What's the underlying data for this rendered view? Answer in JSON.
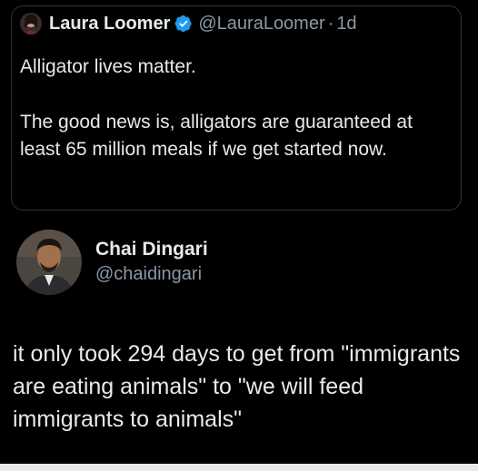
{
  "quoted_tweet": {
    "author_name": "Laura Loomer",
    "author_handle": "@LauraLoomer",
    "separator": "·",
    "time": "1d",
    "line1": "Alligator lives matter.",
    "paragraph": "The good news is, alligators are guaranteed at least 65 million meals if we get started now.",
    "verified_icon": "verified-badge-icon",
    "verified_color": "#1d9bf0"
  },
  "tweet": {
    "author_name": "Chai Dingari",
    "author_handle": "@chaidingari",
    "text": "it only took 294 days to get from \"immigrants are eating animals\" to \"we will feed immigrants to animals\""
  },
  "colors": {
    "background": "#000000",
    "text_primary": "#e7e9ea",
    "text_secondary": "#8b98a5",
    "border": "#2f3336"
  }
}
